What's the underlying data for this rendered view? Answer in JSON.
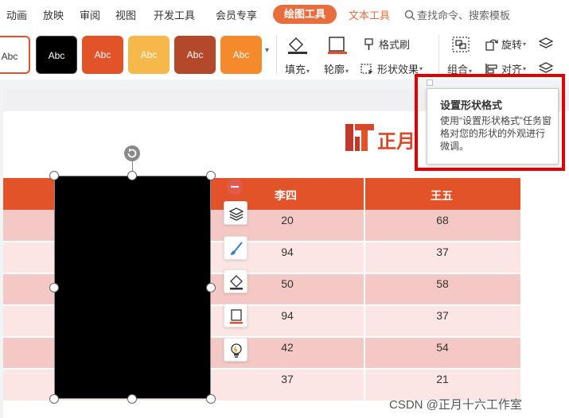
{
  "menu": {
    "items": [
      "动画",
      "放映",
      "审阅",
      "视图",
      "开发工具",
      "会员专享"
    ],
    "active_tab": "绘图工具",
    "text_tab": "文本工具",
    "search_label": "查找命令、搜索模板"
  },
  "ribbon": {
    "styles": [
      "Abc",
      "Abc",
      "Abc",
      "Abc",
      "Abc",
      "Abc"
    ],
    "fill": "填充",
    "outline": "轮廓",
    "format_painter": "格式刷",
    "shape_effects": "形状效果",
    "group": "组合",
    "rotate": "旋转",
    "align": "对齐"
  },
  "tooltip": {
    "title": "设置形状格式",
    "body": "使用“设置形状格式”任务窗格对您的形状的外观进行微调。"
  },
  "slide": {
    "logo_text": "正月"
  },
  "table": {
    "headers": [
      "李四",
      "王五"
    ],
    "rows": [
      [
        "20",
        "68"
      ],
      [
        "94",
        "37"
      ],
      [
        "50",
        "58"
      ],
      [
        "94",
        "37"
      ],
      [
        "42",
        "54"
      ],
      [
        "37",
        "21"
      ]
    ]
  },
  "watermark": "CSDN @正月十六工作室",
  "colors": {
    "accent": "#e96c3c",
    "table_header": "#e2532a",
    "row_dark": "#f4c9c5",
    "row_light": "#fbe6e3",
    "highlight": "#e50000"
  }
}
